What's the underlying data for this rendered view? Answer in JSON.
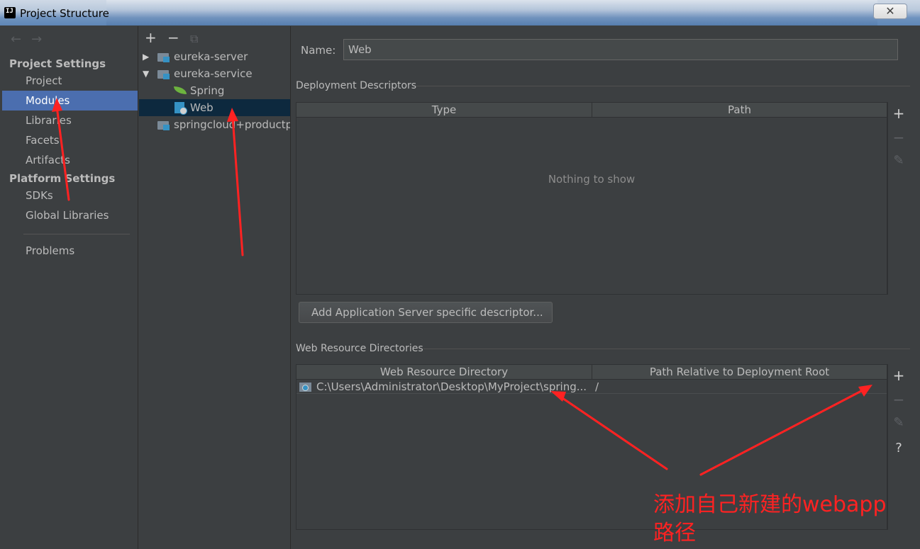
{
  "window": {
    "title": "Project Structure",
    "close_label": "✕"
  },
  "nav": {
    "arrows": "←→",
    "project_settings_header": "Project Settings",
    "project_items": [
      "Project",
      "Modules",
      "Libraries",
      "Facets",
      "Artifacts"
    ],
    "platform_settings_header": "Platform Settings",
    "platform_items": [
      "SDKs",
      "Global Libraries"
    ],
    "problems": "Problems",
    "selected": "Modules"
  },
  "tree": {
    "toolbar": {
      "add": "+",
      "remove": "−",
      "copy": "⧉"
    },
    "items": [
      {
        "label": "eureka-server",
        "arrow": "▶"
      },
      {
        "label": "eureka-service",
        "arrow": "▼"
      },
      {
        "label": "Spring"
      },
      {
        "label": "Web"
      },
      {
        "label": "springcloud+productp"
      }
    ]
  },
  "main": {
    "name_label": "Name:",
    "name_value": "Web",
    "deployment": {
      "title": "Deployment Descriptors",
      "col_type": "Type",
      "col_path": "Path",
      "empty": "Nothing to show",
      "add_button": "Add Application Server specific descriptor..."
    },
    "web_resources": {
      "title": "Web Resource Directories",
      "col_dir": "Web Resource Directory",
      "col_rel": "Path Relative to Deployment Root",
      "rows": [
        {
          "dir": "C:\\Users\\Administrator\\Desktop\\MyProject\\spring...",
          "rel": "/"
        }
      ]
    },
    "tools": {
      "add": "+",
      "remove": "−",
      "edit": "✎",
      "help": "?"
    }
  },
  "annotation": {
    "text_line1": "添加自己新建的webapp",
    "text_line2": "路径",
    "color": "#ff2222"
  }
}
